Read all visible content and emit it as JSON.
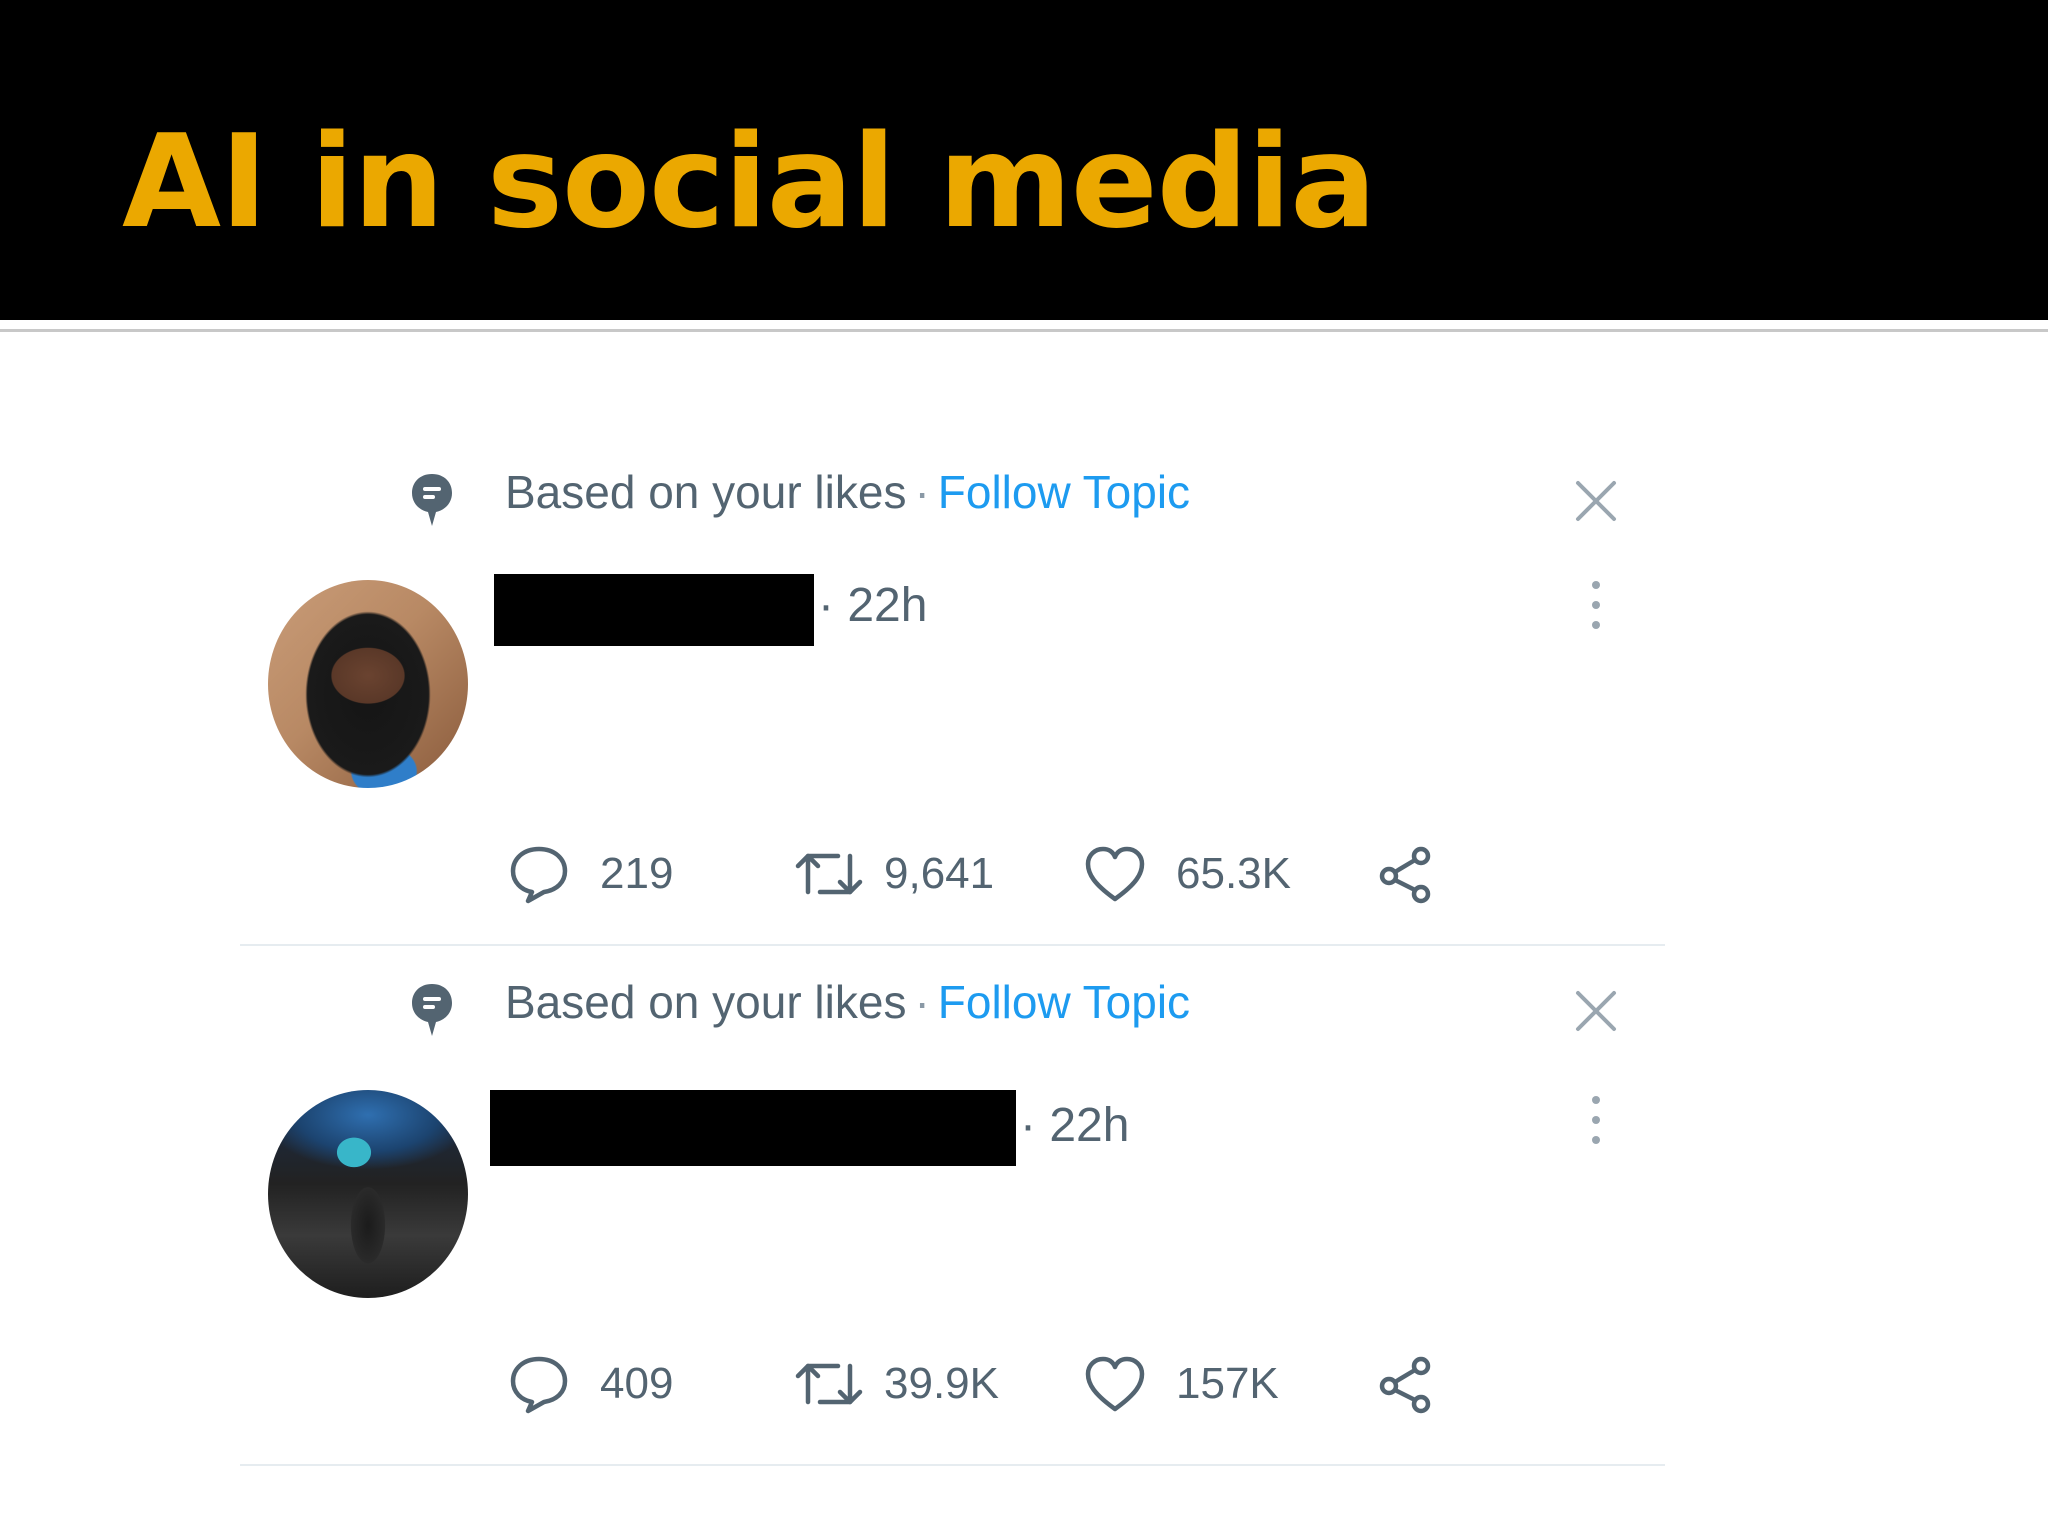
{
  "slide": {
    "title": "AI in social media"
  },
  "colors": {
    "header_background": "#000000",
    "title_color": "#EBA800",
    "link_blue": "#1d9bf0",
    "muted_gray": "#536471"
  },
  "tweets": [
    {
      "context_label": "Based on your likes",
      "separator": "·",
      "follow_label": "Follow Topic",
      "time": "· 22h",
      "author_redacted": true,
      "avatar_icon": "profile-photo-woman",
      "stats": {
        "replies": "219",
        "retweets": "9,641",
        "likes": "65.3K"
      }
    },
    {
      "context_label": "Based on your likes",
      "separator": "·",
      "follow_label": "Follow Topic",
      "time": "· 22h",
      "author_redacted": true,
      "avatar_icon": "profile-photo-man-city",
      "stats": {
        "replies": "409",
        "retweets": "39.9K",
        "likes": "157K"
      }
    }
  ],
  "icons": {
    "context": "topic-bubble-icon",
    "close": "close-icon",
    "more": "more-options-icon",
    "reply": "reply-icon",
    "retweet": "retweet-icon",
    "like": "heart-icon",
    "share": "share-icon"
  }
}
